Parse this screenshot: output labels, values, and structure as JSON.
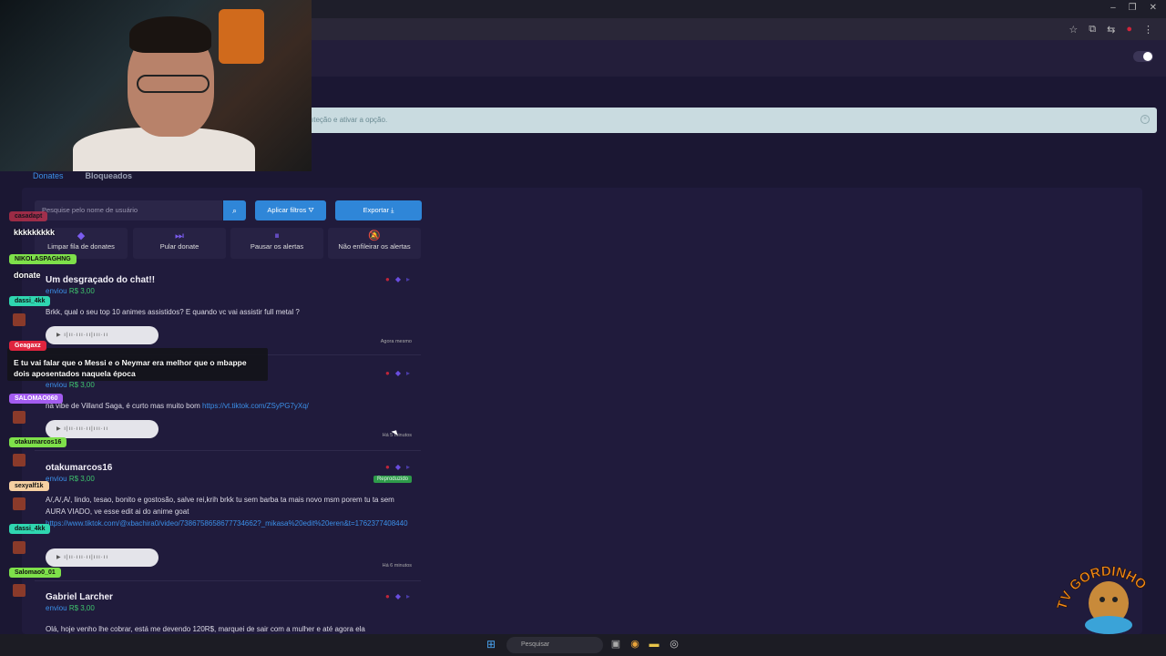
{
  "browser": {
    "window_controls": [
      "–",
      "❐",
      "✕"
    ],
    "addr_icons": [
      "☆",
      "⧉",
      "⇆",
      "●",
      "⋮"
    ]
  },
  "alert": {
    "text": "ıteção e ativar a opção."
  },
  "tabs": [
    {
      "label": "Donates",
      "active": true
    },
    {
      "label": "Bloqueados",
      "active": false
    }
  ],
  "toolbar": {
    "search_placeholder": "Pesquise pelo nome de usuário",
    "filter_label": "Aplicar filtros",
    "export_label": "Exportar"
  },
  "actions": [
    {
      "label": "Limpar fila de donates",
      "icon": "eraser-icon"
    },
    {
      "label": "Pular donate",
      "icon": "skip-icon"
    },
    {
      "label": "Pausar os alertas",
      "icon": "pause-icon"
    },
    {
      "label": "Não enfileirar os alertas",
      "icon": "bell-off-icon"
    }
  ],
  "donations": [
    {
      "name": "Um desgraçado do chat!!",
      "sent": "enviou",
      "amount": "R$ 3,00",
      "message": "Brkk, qual o seu top 10 animes assistidos? E quando vc vai assistir full metal ?",
      "link": "",
      "time": "Agora mesmo",
      "badge": ""
    },
    {
      "name": "",
      "sent": "enviou",
      "amount": "R$ 3,00",
      "message": "na vibe de Villand Saga, é curto mas muito bom",
      "link": "https://vt.tiktok.com/ZSyPG7yXq/",
      "time": "Há 5 minutos",
      "badge": ""
    },
    {
      "name": "otakumarcos16",
      "sent": "enviou",
      "amount": "R$ 3,00",
      "message": "A/,A/,A/, lindo, tesao, bonito e gostosão, salve rei,krih brkk tu sem barba ta mais novo msm porem tu ta sem AURA VIADO, ve esse edit ai do anime goat",
      "link": "https://www.tiktok.com/@xbachira0/video/7386758658677734662?_mikasa%20edit%20eren&t=1762377408440",
      "time": "Há 6 minutos",
      "badge": "Reproduzido"
    },
    {
      "name": "Gabriel Larcher",
      "sent": "enviou",
      "amount": "R$ 3,00",
      "message": "Olá, hoje venho lhe cobrar, está me devendo 120R$, marquei de sair com a mulher e até agora ela",
      "link": "",
      "time": "",
      "badge": ""
    }
  ],
  "audio_wave": "▶  ı|ıı·ııı·ıı|ııı·ıı",
  "chat": [
    {
      "user": "casadapt",
      "color": "#d2344e",
      "msg": "kkkkkkkkk"
    },
    {
      "user": "NIKOLASPAGHNG",
      "color": "#7ee04a",
      "msg": "donate"
    },
    {
      "user": "dassi_4kk",
      "color": "#2fd6b0",
      "msg": ""
    },
    {
      "user": "Geagaxz",
      "color": "#e0243e",
      "msg": "E tu vai falar que o Messi e o Neymar era melhor que o mbappe dois aposentados naquela época"
    },
    {
      "user": "SALOMAO060",
      "color": "#a35cf0",
      "msg": ""
    },
    {
      "user": "otakumarcos16",
      "color": "#7ee04a",
      "msg": ""
    },
    {
      "user": "sexyalf1k",
      "color": "#f6d0a2",
      "msg": ""
    },
    {
      "user": "dassi_4kk",
      "color": "#2fd6b0",
      "msg": ""
    },
    {
      "user": "Salomao0_01",
      "color": "#7ee04a",
      "msg": ""
    }
  ],
  "taskbar": {
    "search_label": "Pesquisar"
  },
  "logo_text": "TV GORDINHO"
}
